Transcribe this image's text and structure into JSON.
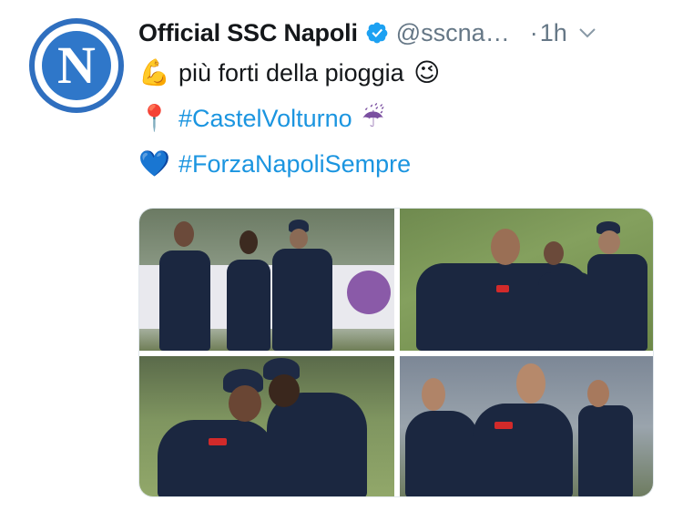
{
  "tweet": {
    "display_name": "Official SSC Napoli",
    "handle": "@sscna…",
    "separator": "·",
    "time": "1h",
    "avatar_letter": "N"
  },
  "body": {
    "line1": {
      "emoji": "💪",
      "text": "più forti della pioggia",
      "emoji_end": "😉"
    },
    "line2": {
      "emoji": "📍",
      "hashtag": "#CastelVolturno",
      "emoji_end": "☔"
    },
    "line3": {
      "emoji": "💙",
      "hashtag": "#ForzaNapoliSempre"
    }
  },
  "colors": {
    "name_text": "#14171a",
    "muted_text": "#657786",
    "hashtag": "#1b95e0",
    "verified_badge": "#1da1f2",
    "avatar_blue": "#2f77c9"
  },
  "icons": {
    "verified": "verified-badge-icon",
    "caret": "chevron-down-icon"
  }
}
